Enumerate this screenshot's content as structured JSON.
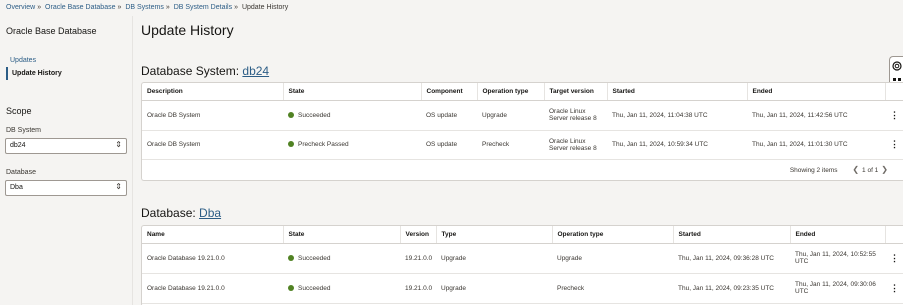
{
  "breadcrumb": [
    "Overview",
    "Oracle Base Database",
    "DB Systems",
    "DB System Details",
    "Update History"
  ],
  "sidebar": {
    "title": "Oracle Base Database",
    "nav": [
      {
        "label": "Updates",
        "active": false
      },
      {
        "label": "Update History",
        "active": true
      }
    ],
    "scope_title": "Scope",
    "db_system_label": "DB System",
    "db_system_value": "db24",
    "database_label": "Database",
    "database_value": "Dba"
  },
  "page_title": "Update History",
  "db_system_section": {
    "title_prefix": "Database System: ",
    "title_link": "db24",
    "columns": [
      "Description",
      "State",
      "Component",
      "Operation type",
      "Target version",
      "Started",
      "Ended"
    ],
    "rows": [
      {
        "description": "Oracle DB System",
        "state": "Succeeded",
        "component": "OS update",
        "operation": "Upgrade",
        "target_line1": "Oracle Linux",
        "target_line2": "Server release 8",
        "started": "Thu, Jan 11, 2024, 11:04:38 UTC",
        "ended": "Thu, Jan 11, 2024, 11:42:56 UTC"
      },
      {
        "description": "Oracle DB System",
        "state": "Precheck Passed",
        "component": "OS update",
        "operation": "Precheck",
        "target_line1": "Oracle Linux",
        "target_line2": "Server release 8",
        "started": "Thu, Jan 11, 2024, 10:59:34 UTC",
        "ended": "Thu, Jan 11, 2024, 11:01:30 UTC"
      }
    ],
    "footer_showing": "Showing 2 items",
    "footer_page": "1 of 1"
  },
  "database_section": {
    "title_prefix": "Database: ",
    "title_link": "Dba",
    "columns": [
      "Name",
      "State",
      "Version",
      "Type",
      "Operation type",
      "Started",
      "Ended"
    ],
    "rows": [
      {
        "name": "Oracle Database 19.21.0.0",
        "state": "Succeeded",
        "version": "19.21.0.0",
        "type": "Upgrade",
        "operation": "Upgrade",
        "started": "Thu, Jan 11, 2024, 09:36:28 UTC",
        "ended_line1": "Thu, Jan 11, 2024, 10:52:55",
        "ended_line2": "UTC"
      },
      {
        "name": "Oracle Database 19.21.0.0",
        "state": "Succeeded",
        "version": "19.21.0.0",
        "type": "Upgrade",
        "operation": "Precheck",
        "started": "Thu, Jan 11, 2024, 09:23:35 UTC",
        "ended_line1": "Thu, Jan 11, 2024, 09:30:06",
        "ended_line2": "UTC"
      }
    ]
  },
  "colors": {
    "link": "#2c5d86",
    "success": "#508223",
    "background": "#f5f4f2"
  },
  "icons": [
    "chevron-updown-icon",
    "kebab-menu-icon",
    "chevron-left-icon",
    "chevron-right-icon",
    "lifebuoy-help-icon",
    "status-success-dot-icon"
  ]
}
